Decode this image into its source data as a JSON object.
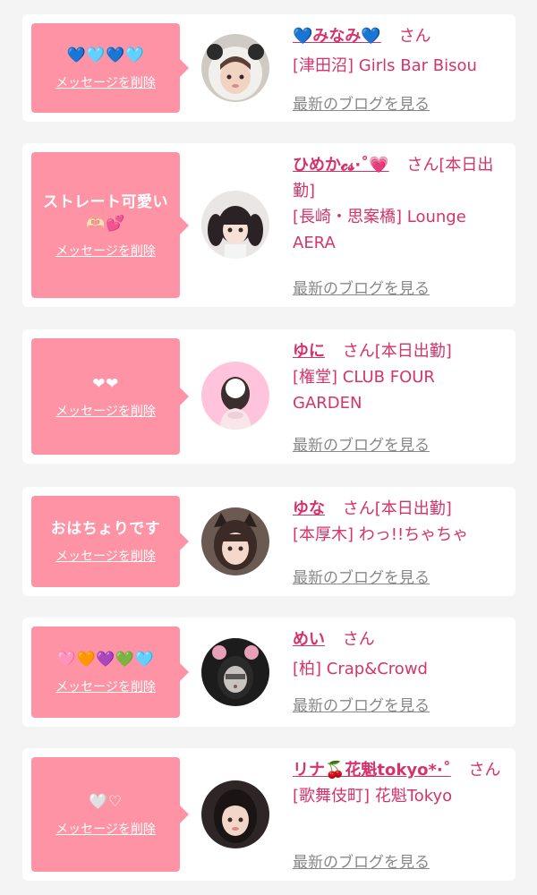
{
  "delete_label": "メッセージを削除",
  "san_label": "さん",
  "blog_label": "最新のブログを見る",
  "colors": {
    "accent": "#d6336c",
    "bubble": "#ff93a6",
    "link_gray": "#888888"
  },
  "cards": [
    {
      "message": "💙🩵💙🩵",
      "name": "💙みなみ💙",
      "status": "",
      "shop": "[津田沼] Girls Bar Bisou",
      "avatar_icon": "avatar-panda-hood"
    },
    {
      "message": "ストレート可愛い🫶🏻💕",
      "name": "ひめか𝓬𝓼·˚💗",
      "status": "[本日出勤]",
      "shop": "[長崎・思案橋] Lounge AERA",
      "avatar_icon": "avatar-twin-tails"
    },
    {
      "message": "❤︎❤︎",
      "name": "ゆに",
      "status": "[本日出勤]",
      "shop": "[権堂] CLUB FOUR GARDEN",
      "avatar_icon": "avatar-pink-bg"
    },
    {
      "message": "おはちょりです",
      "name": "ゆな",
      "status": "[本日出勤]",
      "shop": "[本厚木] わっ!!ちゃちゃ",
      "avatar_icon": "avatar-cat-ears"
    },
    {
      "message": "🩷🧡💜💚🩵",
      "name": "めい",
      "status": "",
      "shop": "[柏] Crap&Crowd",
      "avatar_icon": "avatar-bear-ears"
    },
    {
      "message": "🤍♡",
      "name": "リナ🍒花魁tokyo*·˚",
      "status": "",
      "shop": "[歌舞伎町] 花魁Tokyo",
      "avatar_icon": "avatar-dark-hair"
    }
  ]
}
